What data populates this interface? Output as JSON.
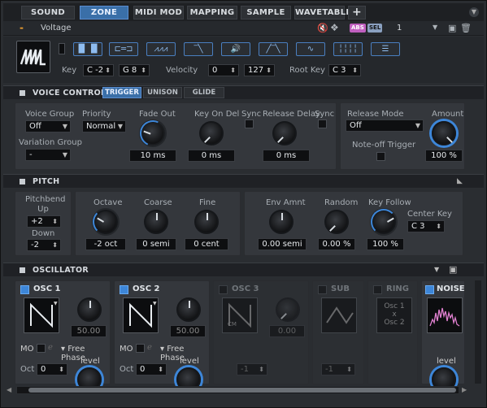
{
  "tabs": [
    "SOUND",
    "ZONE",
    "MIDI MOD",
    "MAPPING",
    "SAMPLE",
    "WAVETABLE",
    "+"
  ],
  "active_tab": "ZONE",
  "header": {
    "title": "Voltage",
    "abs": "ABS",
    "sel": "SEL",
    "number": "1",
    "minus": "-"
  },
  "zone": {
    "key_label": "Key",
    "key_low": "C -2",
    "key_high": "G 8",
    "velocity_label": "Velocity",
    "vel_low": "0",
    "vel_high": "127",
    "rootkey_label": "Root Key",
    "rootkey": "C 3"
  },
  "voice_control": {
    "title": "VOICE CONTROL",
    "subtabs": [
      "TRIGGER",
      "UNISON",
      "GLIDE"
    ],
    "voice_group_label": "Voice Group",
    "voice_group": "Off",
    "priority_label": "Priority",
    "priority": "Normal",
    "variation_group_label": "Variation Group",
    "variation_group": "-",
    "fade_out_label": "Fade Out",
    "fade_out": "10 ms",
    "key_on_del_label": "Key On Del",
    "key_on_del": "0 ms",
    "sync1_label": "Sync",
    "release_delay_label": "Release Delay",
    "release_delay": "0 ms",
    "sync2_label": "Sync",
    "release_mode_label": "Release Mode",
    "release_mode": "Off",
    "amount_label": "Amount",
    "amount": "100 %",
    "noteoff_label": "Note-off Trigger"
  },
  "pitch": {
    "title": "PITCH",
    "pitchbend_up_label": "Pitchbend\nUp",
    "pitchbend_up": "+2",
    "down_label": "Down",
    "down": "-2",
    "octave_label": "Octave",
    "octave": "-2 oct",
    "coarse_label": "Coarse",
    "coarse": "0 semi",
    "fine_label": "Fine",
    "fine": "0 cent",
    "env_amnt_label": "Env Amnt",
    "env_amnt": "0.00 semi",
    "random_label": "Random",
    "random": "0.00 %",
    "key_follow_label": "Key Follow",
    "key_follow": "100 %",
    "center_key_label": "Center Key",
    "center_key": "C 3"
  },
  "oscillator": {
    "title": "OSCILLATOR",
    "osc1": {
      "label": "OSC 1",
      "value": "50.00",
      "mo": "MO",
      "phase": "Free Phase",
      "level": "level",
      "oct_label": "Oct",
      "oct": "0"
    },
    "osc2": {
      "label": "OSC 2",
      "value": "50.00",
      "mo": "MO",
      "phase": "Free Phase",
      "level": "level",
      "oct_label": "Oct",
      "oct": "0"
    },
    "osc3": {
      "label": "OSC 3",
      "value": "0.00",
      "cm": "CM",
      "oct": "-1"
    },
    "sub": {
      "label": "SUB",
      "oct": "-1"
    },
    "ring": {
      "label": "RING",
      "osc1": "Osc 1",
      "x": "x",
      "osc2": "Osc 2"
    },
    "noise": {
      "label": "NOISE",
      "level": "level"
    }
  },
  "colors": {
    "accent": "#3d86d8",
    "knob_ring": "#4a9ae8",
    "orange": "#f0a030",
    "pink": "#e080d0"
  }
}
